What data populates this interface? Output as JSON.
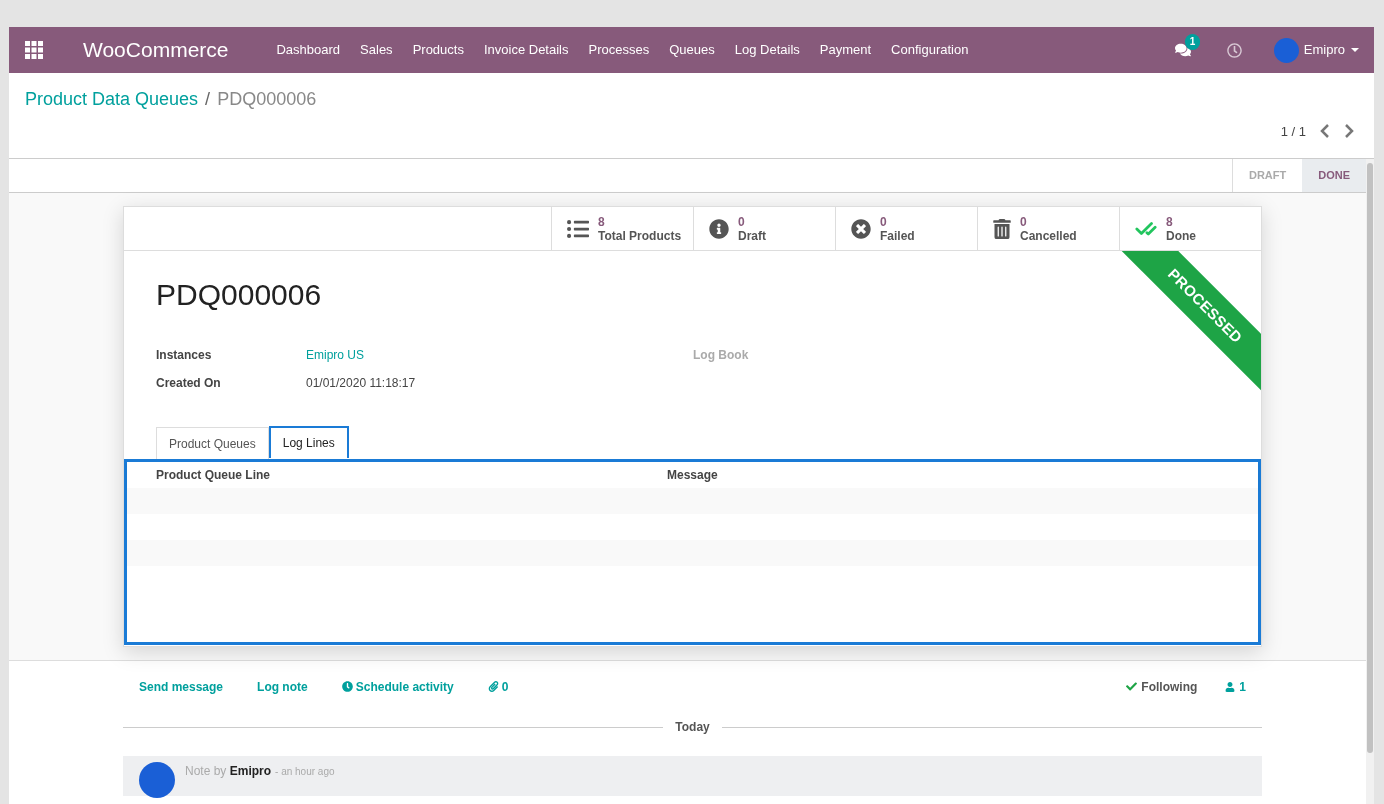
{
  "app": {
    "name": "WooCommerce",
    "menu": [
      "Dashboard",
      "Sales",
      "Products",
      "Invoice Details",
      "Processes",
      "Queues",
      "Log Details",
      "Payment",
      "Configuration"
    ],
    "messages_badge": "1",
    "user": "Emipro"
  },
  "breadcrumb": {
    "parent": "Product Data Queues",
    "separator": "/",
    "current": "PDQ000006"
  },
  "pager": "1 / 1",
  "statusbar": [
    {
      "label": "DRAFT",
      "selected": false
    },
    {
      "label": "DONE",
      "selected": true
    }
  ],
  "stat_buttons": [
    {
      "kind": "list",
      "value": "8",
      "label": "Total Products"
    },
    {
      "kind": "info",
      "value": "0",
      "label": "Draft"
    },
    {
      "kind": "failed",
      "value": "0",
      "label": "Failed"
    },
    {
      "kind": "trash",
      "value": "0",
      "label": "Cancelled"
    },
    {
      "kind": "done",
      "value": "8",
      "label": "Done"
    }
  ],
  "ribbon": "PROCESSED",
  "record": {
    "title": "PDQ000006",
    "fields": [
      {
        "label": "Instances",
        "value": "Emipro US",
        "kind": "link"
      },
      {
        "label": "Created On",
        "value": "01/01/2020 11:18:17",
        "kind": "text"
      }
    ],
    "right_fields": [
      {
        "label": "Log Book"
      }
    ]
  },
  "tabs": [
    {
      "label": "Product Queues",
      "selected": false
    },
    {
      "label": "Log Lines",
      "selected": true
    }
  ],
  "table": {
    "columns": [
      "Product Queue Line",
      "Message"
    ]
  },
  "chatter": {
    "actions": [
      "Send message",
      "Log note",
      "Schedule activity"
    ],
    "attachments": "0",
    "following": "Following",
    "followers": "1",
    "separator": "Today",
    "message": {
      "author_line": "Note by **Emipro**",
      "time": "- an hour ago"
    }
  }
}
